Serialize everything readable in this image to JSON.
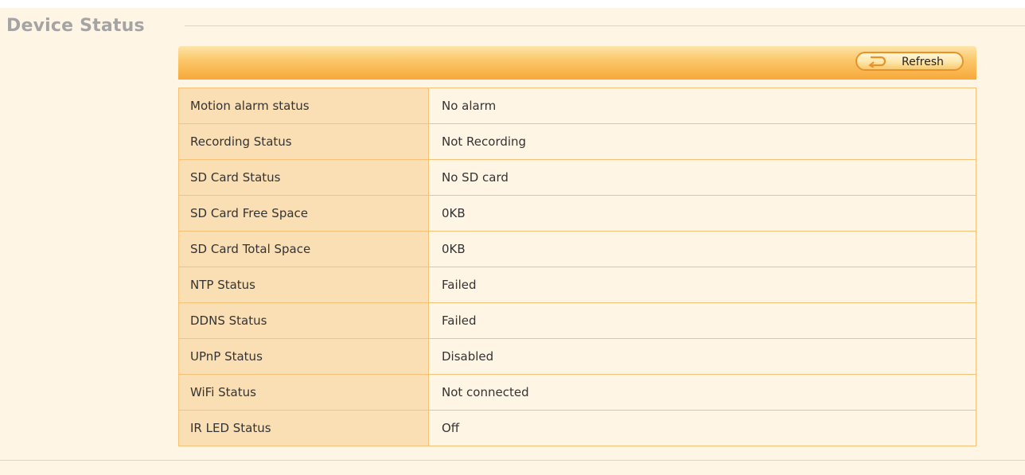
{
  "page": {
    "title": "Device Status"
  },
  "toolbar": {
    "refresh_label": "Refresh"
  },
  "rows": [
    {
      "label": "Motion alarm status",
      "value": "No alarm"
    },
    {
      "label": "Recording Status",
      "value": "Not Recording"
    },
    {
      "label": "SD Card Status",
      "value": "No SD card"
    },
    {
      "label": "SD Card Free Space",
      "value": "0KB"
    },
    {
      "label": "SD Card Total Space",
      "value": "0KB"
    },
    {
      "label": "NTP Status",
      "value": "Failed"
    },
    {
      "label": "DDNS Status",
      "value": "Failed"
    },
    {
      "label": "UPnP Status",
      "value": "Disabled"
    },
    {
      "label": "WiFi Status",
      "value": "Not connected"
    },
    {
      "label": "IR LED Status",
      "value": "Off"
    }
  ],
  "colors": {
    "background": "#fff5e4",
    "label_cell": "#fbdfb4",
    "border": "#f7c277",
    "toolbar_top": "#fde4a8",
    "toolbar_bottom": "#f7a93a",
    "title_text": "#a4a4a4"
  },
  "icons": {
    "refresh": "refresh-arrow-icon"
  }
}
